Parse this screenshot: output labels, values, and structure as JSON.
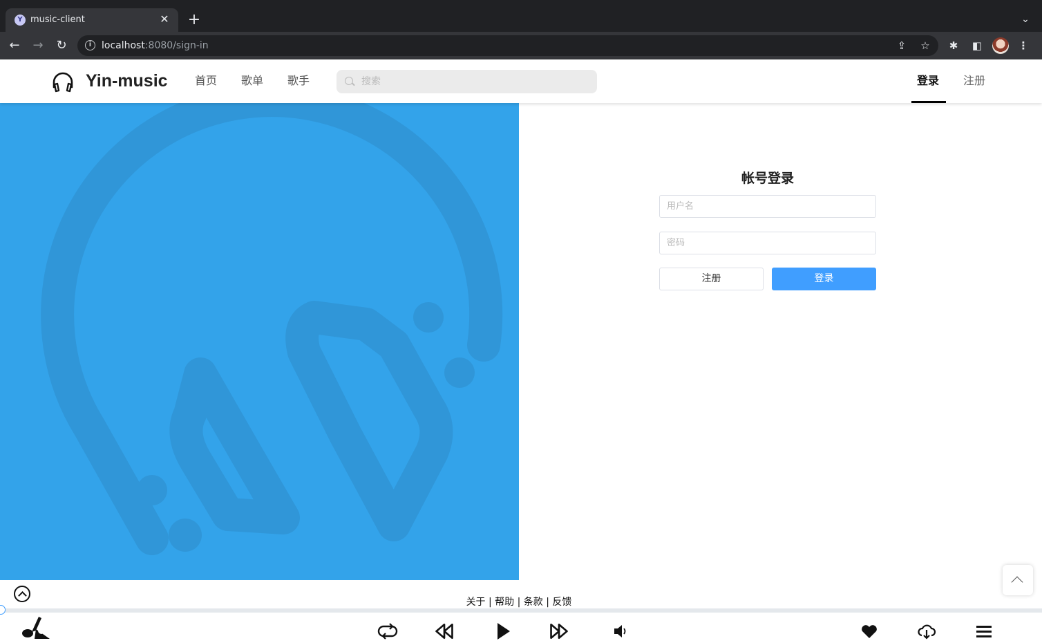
{
  "browser": {
    "tab_title": "music-client",
    "tab_close": "✕",
    "new_tab": "+",
    "favicon_letter": "Y",
    "url_host": "localhost",
    "url_path": ":8080/sign-in"
  },
  "header": {
    "brand": "Yin-music",
    "nav": [
      "首页",
      "歌单",
      "歌手"
    ],
    "search_placeholder": "搜索",
    "login": "登录",
    "register": "注册"
  },
  "login_form": {
    "title": "帐号登录",
    "username_placeholder": "用户名",
    "password_placeholder": "密码",
    "register_button": "注册",
    "login_button": "登录"
  },
  "footer": {
    "links": "关于 | 帮助 | 条款 | 反馈"
  },
  "player": {
    "progress": 0
  },
  "colors": {
    "hero_bg": "#33a3ea",
    "hero_logo": "#3096d8",
    "primary": "#409eff"
  }
}
